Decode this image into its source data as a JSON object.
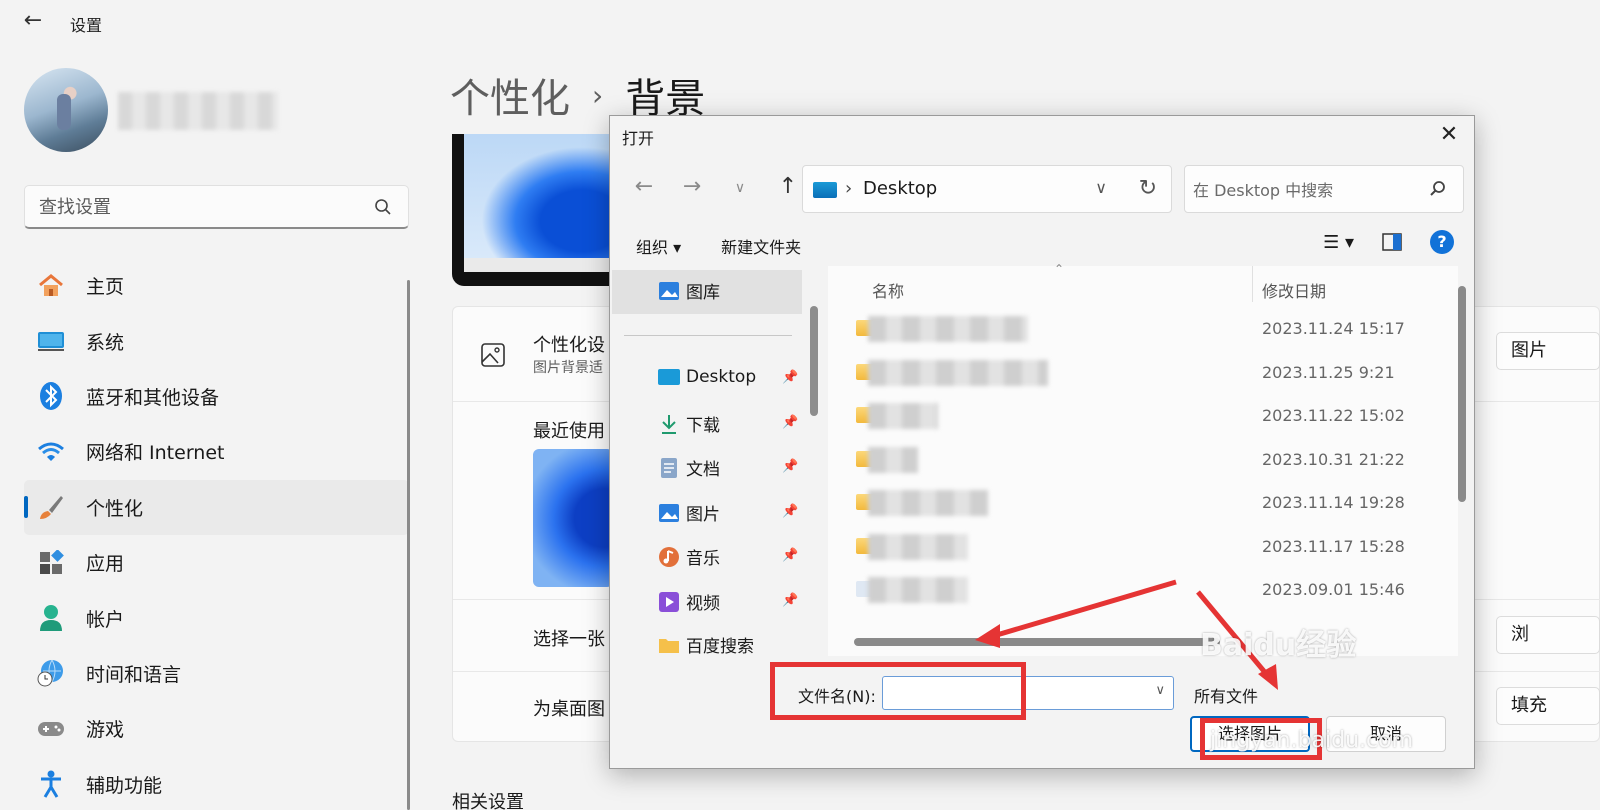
{
  "app": {
    "title": "设置",
    "back_icon": "back-arrow-icon"
  },
  "search": {
    "placeholder": "查找设置"
  },
  "nav": [
    {
      "label": "主页",
      "icon": "home-icon"
    },
    {
      "label": "系统",
      "icon": "system-icon"
    },
    {
      "label": "蓝牙和其他设备",
      "icon": "bluetooth-icon"
    },
    {
      "label": "网络和 Internet",
      "icon": "wifi-icon"
    },
    {
      "label": "个性化",
      "icon": "brush-icon",
      "active": true
    },
    {
      "label": "应用",
      "icon": "apps-icon"
    },
    {
      "label": "帐户",
      "icon": "account-icon"
    },
    {
      "label": "时间和语言",
      "icon": "globe-clock-icon"
    },
    {
      "label": "游戏",
      "icon": "gamepad-icon"
    },
    {
      "label": "辅助功能",
      "icon": "accessibility-icon"
    }
  ],
  "page": {
    "crumb": "个性化",
    "separator": "›",
    "current": "背景"
  },
  "background": {
    "personalize_title": "个性化设",
    "personalize_sub": "图片背景适",
    "recent_label": "最近使用",
    "choose_label": "选择一张",
    "fit_label": "为桌面图",
    "type_button": "图片",
    "browse_button": "浏",
    "fit_button": "填充",
    "related": "相关设置"
  },
  "dialog": {
    "title": "打开",
    "address": "Desktop",
    "search_placeholder": "在 Desktop 中搜索",
    "organize": "组织 ▾",
    "new_folder": "新建文件夹",
    "sidebar": [
      {
        "label": "图库",
        "icon": "gallery-icon",
        "pinned": false
      },
      {
        "label": "Desktop",
        "icon": "desktop-icon",
        "pinned": true
      },
      {
        "label": "下载",
        "icon": "download-icon",
        "pinned": true
      },
      {
        "label": "文档",
        "icon": "documents-icon",
        "pinned": true
      },
      {
        "label": "图片",
        "icon": "pictures-icon",
        "pinned": true
      },
      {
        "label": "音乐",
        "icon": "music-icon",
        "pinned": true
      },
      {
        "label": "视频",
        "icon": "video-icon",
        "pinned": true
      },
      {
        "label": "百度搜索",
        "icon": "folder-icon",
        "pinned": false
      }
    ],
    "columns": {
      "name": "名称",
      "modified": "修改日期"
    },
    "files": [
      {
        "date": "2023.11.24 15:17"
      },
      {
        "date": "2023.11.25 9:21"
      },
      {
        "date": "2023.11.22 15:02"
      },
      {
        "date": "2023.10.31 21:22"
      },
      {
        "date": "2023.11.14 19:28"
      },
      {
        "date": "2023.11.17 15:28"
      },
      {
        "date": "2023.09.01 15:46"
      }
    ],
    "filename_label": "文件名(N):",
    "filename_value": "",
    "filetype": "所有文件",
    "ok_button": "选择图片",
    "cancel_button": "取消"
  },
  "watermark": {
    "brand": "Baidu经验",
    "url": "jingyan.baidu.com"
  },
  "colors": {
    "accent": "#0067c0",
    "annotation": "#e53434"
  }
}
